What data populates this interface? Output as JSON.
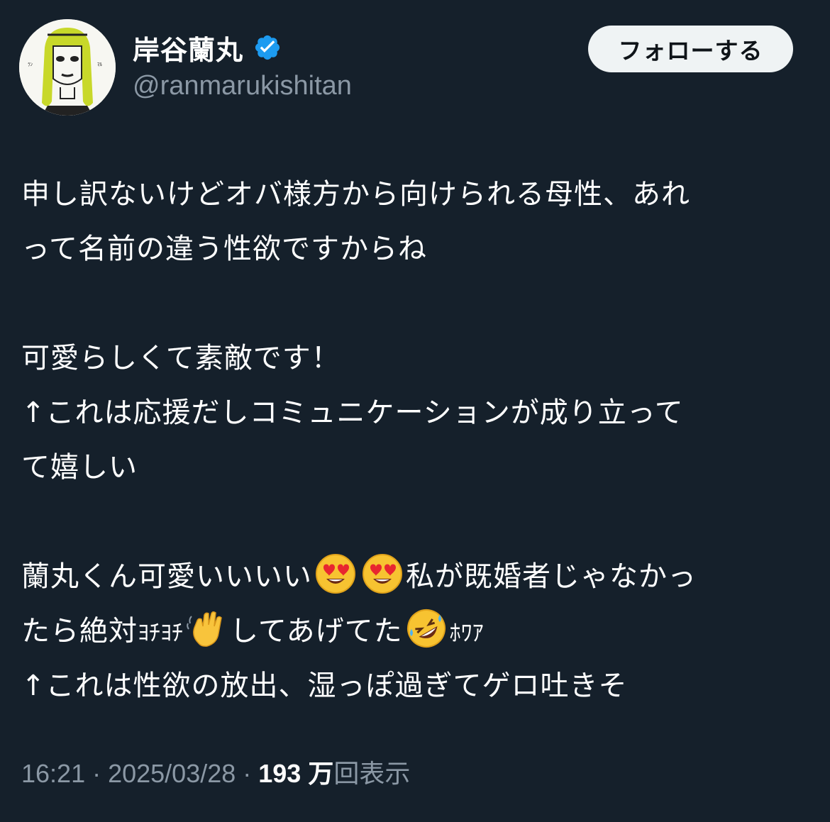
{
  "tweet": {
    "author": {
      "display_name": "岸谷蘭丸",
      "handle": "@ranmarukishitan",
      "verified": true,
      "avatar_icon": "avatar-illustration"
    },
    "follow_button_label": "フォローする",
    "text_lines": [
      "申し訳ないけどオバ様方から向けられる母性、あれ",
      "って名前の違う性欲ですからね",
      "",
      "可愛らしくて素敵です！",
      "↑これは応援だしコミュニケーションが成り立って",
      "て嬉しい",
      "",
      "蘭丸くん可愛いいいい",
      "私が既婚者じゃなかっ",
      "たら絶対",
      "ﾖﾁﾖﾁ",
      "してあげてた",
      "ﾎﾜｱ",
      "↑これは性欲の放出、湿っぽ過ぎてゲロ吐きそ"
    ],
    "emojis": [
      "smiling-face-with-heart-eyes",
      "smiling-face-with-heart-eyes",
      "waving-hand",
      "rolling-on-floor-laughing"
    ],
    "timestamp": "16:21 · 2025/03/28 · ",
    "view_count": "193 万",
    "view_label": "回表示"
  },
  "colors": {
    "background": "#15202b",
    "text_primary": "#ffffff",
    "text_secondary": "#8b98a5",
    "verified_blue": "#1d9bf0",
    "button_bg": "#eff3f4"
  }
}
